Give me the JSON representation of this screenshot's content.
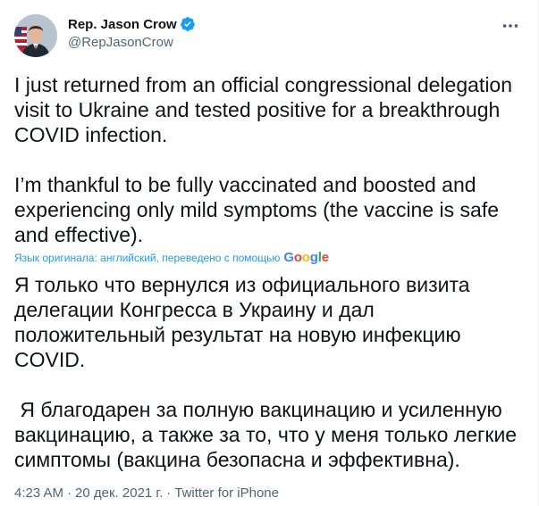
{
  "author": {
    "name": "Rep. Jason Crow",
    "handle": "@RepJasonCrow",
    "verified_color": "#1d9bf0"
  },
  "icons": {
    "avatar": "profile-photo",
    "verified": "verified-badge-icon",
    "more": "more-options-icon"
  },
  "tweet": {
    "original_text": "I just returned from an official congressional delegation\nvisit to Ukraine and tested positive for a breakthrough\nCOVID infection.\n\nI’m thankful to be fully vaccinated and boosted and\nexperiencing only mild symptoms (the vaccine is safe\nand effective).",
    "translation_notice": "Язык оригинала: английский, переведено с помощью",
    "google_letters": [
      "G",
      "o",
      "o",
      "g",
      "l",
      "e"
    ],
    "translated_text": "Я только что вернулся из официального визита\nделегации Конгресса в Украину и дал\nположительный результат на новую инфекцию\nCOVID.\n\n Я благодарен за полную вакцинацию и усиленную\nвакцинацию, а также за то, что у меня только легкие\nсимптомы (вакцина безопасна и эффективна).",
    "time": "4:23 AM",
    "separator": "·",
    "date": "20 дек. 2021 г.",
    "source": "Twitter for iPhone"
  }
}
